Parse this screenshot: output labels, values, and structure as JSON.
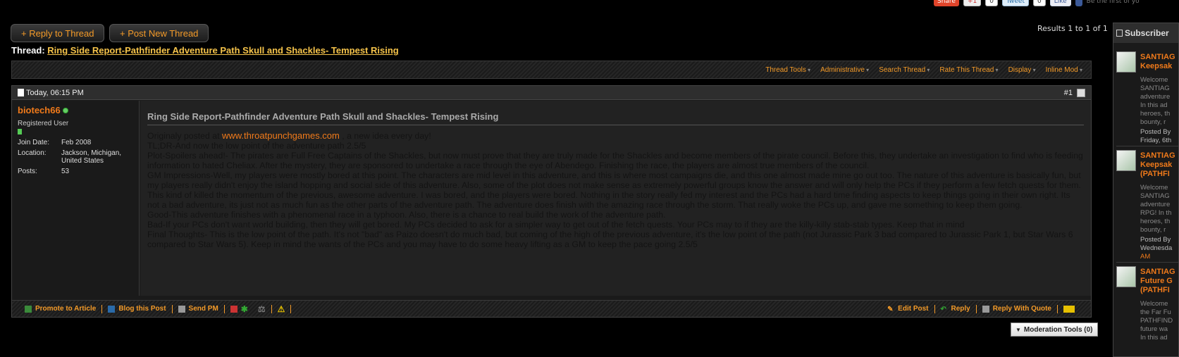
{
  "social": {
    "share_label": "Share",
    "gplus_label": "+1",
    "gplus_count": "0",
    "tweet_label": "Tweet",
    "tweet_count": "0",
    "like_label": "Like",
    "like_hint": "Be the first of yo"
  },
  "buttons": {
    "reply_thread": "+ Reply to Thread",
    "new_thread": "+ Post New Thread"
  },
  "results": "Results 1 to 1 of 1",
  "thread": {
    "prefix": "Thread:",
    "title": "Ring Side Report-Pathfinder Adventure Path Skull and Shackles- Tempest Rising"
  },
  "toolbar": {
    "items": [
      "Thread Tools",
      "Administrative",
      "Search Thread",
      "Rate This Thread",
      "Display",
      "Inline Mod"
    ]
  },
  "post": {
    "date": "Today, 06:15 PM",
    "number": "#1",
    "user": {
      "name": "biotech66",
      "title": "Registered User",
      "join_label": "Join Date:",
      "join_value": "Feb 2008",
      "location_label": "Location:",
      "location_value": "Jackson, Michigan, United States",
      "posts_label": "Posts:",
      "posts_value": "53"
    },
    "title": "Ring Side Report-Pathfinder Adventure Path Skull and Shackles- Tempest Rising",
    "body": {
      "orig_prefix": "Originaly posted at ",
      "orig_site": "www.throatpunchgames.com",
      "orig_suffix": " , a new idea every day!",
      "lines": [
        "TL;DR-And now the low point of the adventure path 2.5/5",
        "Plot-Spoilers ahead!- The pirates are Full Free Captains of the Shackles, but now must prove that they are truly made for the Shackles and become members of the pirate council. Before this, they undertake an investigation to find who is feeding information to hated Cheliax. After the mystery, they are sponsored to undertake a race through the eye of Abendego. Finishing the race, the players are almost true members of the council.",
        "GM Impressions-Well, my players were mostly bored at this point. The characters are mid level in this adventure, and this is where most campaigns die, and this one almost made mine go out too. The nature of this adventure is basically fun, but my players really didn't enjoy the island hopping and social side of this adventure. Also, some of the plot does not make sense as extremely powerful groups know the answer and will only help the PCs if they perform a few fetch quests for them. This kind of killed the momentum of the previous, awesome adventure. I was bored, and the players were bored. Nothing in the story really fed my interest and the PCs had a hard time finding aspects to keep things going in their own right. Its not a bad adventure, its just not as much fun as the other parts of the adventure path. The adventure does finish with the amazing race through the storm. That really woke the PCs up, and gave me something to keep them going.",
        "Good-This adventure finishes with a phenomenal race in a typhoon. Also, there is a chance to real build the work of the adventure path.",
        "Bad-If your PCs don't want world building, then they will get bored. My PCs decided to ask for a simpler way to get out of the fetch quests. Your PCs may to if they are the killy-killy stab-stab types. Keep that in mind",
        "Final Thoughts- This is the low point of the path. It's not \"bad\" as Paizo doesn't do much bad, but coming of the high of the previous adventure, it's the low point of the path (not Jurassic Park 3 bad compared to Jurassic Park 1, but Star Wars 6 compared to Star Wars 5). Keep in mind the wants of the PCs and you may have to do some heavy lifting as a GM to keep the pace going 2.5/5"
      ]
    },
    "footer": {
      "promote": "Promote to Article",
      "blog": "Blog this Post",
      "send_pm": "Send PM",
      "edit": "Edit Post",
      "reply": "Reply",
      "quote": "Reply With Quote"
    }
  },
  "moderation": "Moderation Tools (0)",
  "sidebar": {
    "header": "Subscriber",
    "items": [
      {
        "title": [
          "SANTIAG",
          "Keepsak"
        ],
        "text": [
          "Welcome",
          "SANTIAG",
          "adventure",
          "In this ad",
          "heroes, th",
          "bounty, r"
        ],
        "meta": [
          "Posted By",
          "Friday, 6th"
        ]
      },
      {
        "title": [
          "SANTIAG",
          "Keepsak",
          "(PATHFI"
        ],
        "text": [
          "Welcome",
          "SANTIAG",
          "adventure",
          "RPG! In th",
          "heroes, th",
          "bounty, r"
        ],
        "meta": [
          "Posted By",
          "Wednesda",
          "AM"
        ]
      },
      {
        "title": [
          "SANTIAG",
          "Future G",
          "(PATHFI"
        ],
        "text": [
          "Welcome",
          "the Far Fu",
          "PATHFIND",
          "future wa",
          "In this ad"
        ],
        "meta": []
      }
    ]
  },
  "colors": {
    "accent": "#f39a28",
    "username": "#f07a1a",
    "thread_link": "#f5c34a",
    "background": "#000000"
  }
}
